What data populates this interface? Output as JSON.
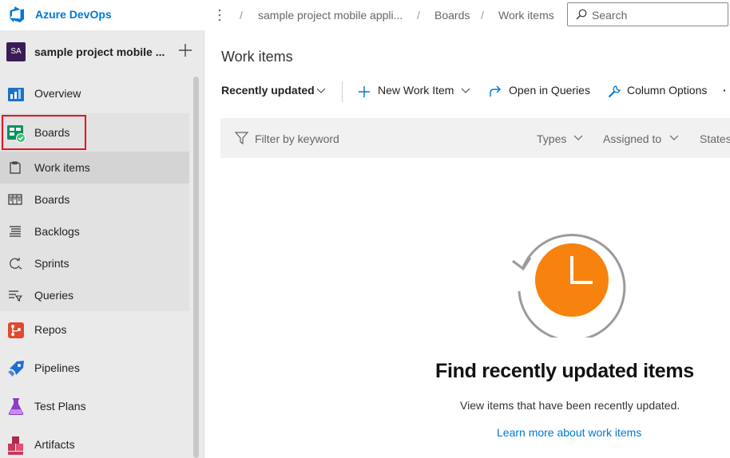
{
  "brand": {
    "name": "Azure DevOps"
  },
  "project": {
    "avatar_initials": "SA",
    "name": "sample project mobile ..."
  },
  "sidebar": {
    "items": [
      {
        "label": "Overview"
      },
      {
        "label": "Boards"
      },
      {
        "label": "Repos"
      },
      {
        "label": "Pipelines"
      },
      {
        "label": "Test Plans"
      },
      {
        "label": "Artifacts"
      }
    ],
    "boards_sub": [
      {
        "label": "Work items"
      },
      {
        "label": "Boards"
      },
      {
        "label": "Backlogs"
      },
      {
        "label": "Sprints"
      },
      {
        "label": "Queries"
      }
    ]
  },
  "breadcrumb": {
    "project": "sample project mobile appli...",
    "section": "Boards",
    "page": "Work items",
    "separator": "/"
  },
  "search": {
    "placeholder": "Search"
  },
  "page": {
    "title": "Work items"
  },
  "toolbar": {
    "view_label": "Recently updated",
    "new_item_label": "New Work Item",
    "open_queries_label": "Open in Queries",
    "column_options_label": "Column Options",
    "overflow": "·"
  },
  "filter": {
    "placeholder": "Filter by keyword",
    "types": "Types",
    "assigned": "Assigned to",
    "states": "States"
  },
  "empty_state": {
    "title": "Find recently updated items",
    "description": "View items that have been recently updated.",
    "link": "Learn more about work items"
  },
  "colors": {
    "accent": "#0078d4",
    "highlight": "#e81123",
    "clock": "#f7820d"
  }
}
